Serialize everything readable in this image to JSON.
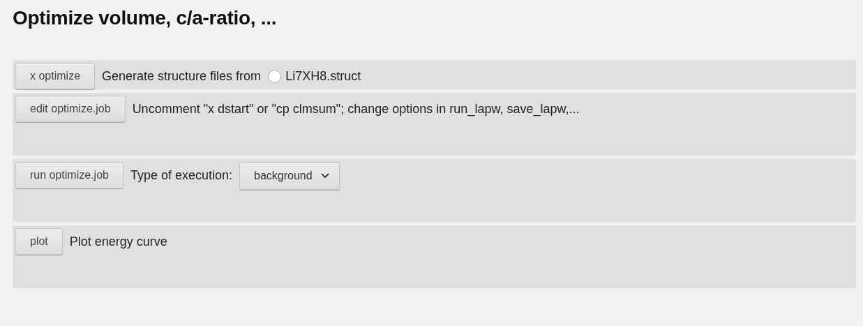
{
  "title": "Optimize volume, c/a-ratio, ...",
  "rows": [
    {
      "kind": "radio",
      "button": "x optimize",
      "text": "Generate structure files from",
      "option": {
        "label": "Li7XH8.struct",
        "selected": false
      }
    },
    {
      "kind": "text",
      "button": "edit optimize.job",
      "text": "Uncomment \"x dstart\" or \"cp clmsum\"; change options in run_lapw, save_lapw,..."
    },
    {
      "kind": "select",
      "button": "run optimize.job",
      "text": "Type of execution:",
      "value": "background"
    },
    {
      "kind": "text",
      "button": "plot",
      "text": "Plot energy curve"
    }
  ]
}
